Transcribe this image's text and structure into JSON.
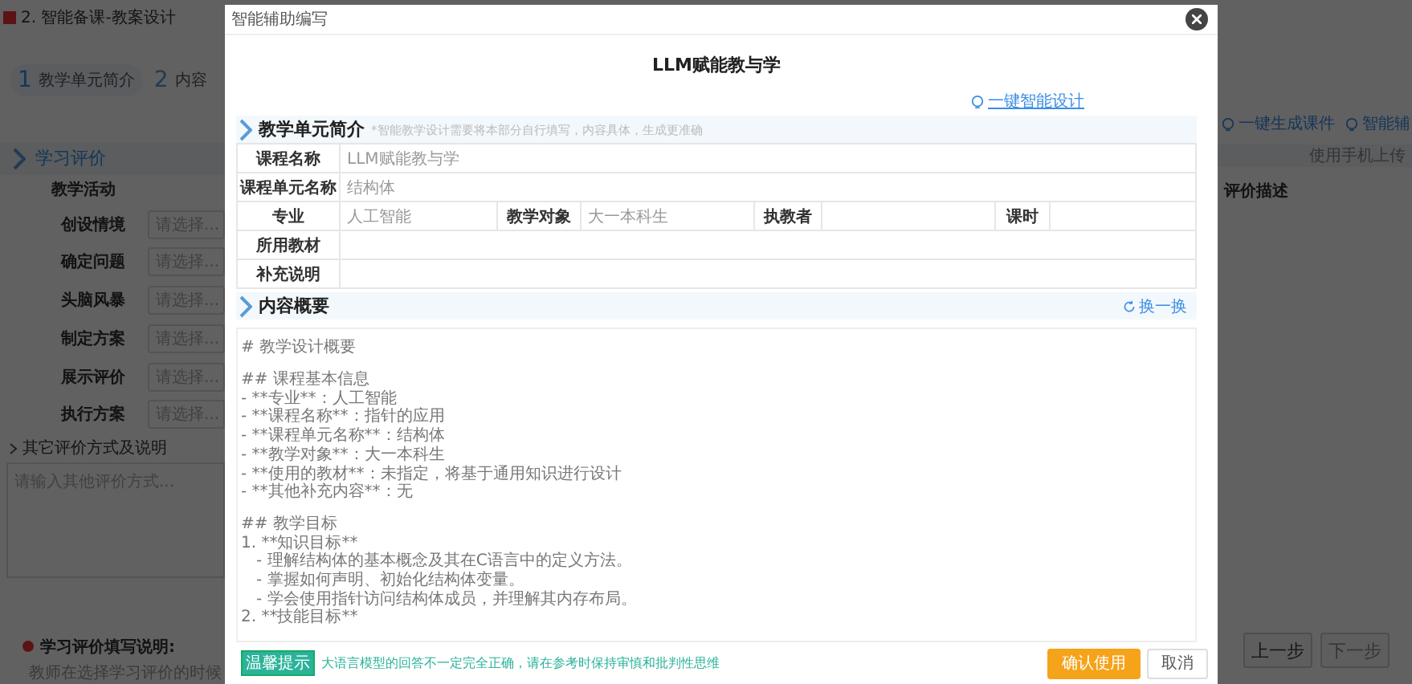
{
  "background": {
    "title": "2. 智能备课-教案设计",
    "steps": [
      {
        "number": "1",
        "label": "教学单元简介",
        "selected": true
      },
      {
        "number": "2",
        "label": "内容",
        "selected": false
      }
    ],
    "section_title": "学习评价",
    "column_header": "教学活动",
    "activities": [
      {
        "label": "创设情境",
        "placeholder": "请选择..."
      },
      {
        "label": "确定问题",
        "placeholder": "请选择..."
      },
      {
        "label": "头脑风暴",
        "placeholder": "请选择..."
      },
      {
        "label": "制定方案",
        "placeholder": "请选择..."
      },
      {
        "label": "展示评价",
        "placeholder": "请选择..."
      },
      {
        "label": "执行方案",
        "placeholder": "请选择..."
      }
    ],
    "other_label": "其它评价方式及说明",
    "other_placeholder": "请输入其他评价方式...",
    "note_title": "学习评价填写说明:",
    "note_text": "教师在选择学习评价的时候",
    "right_actions": [
      "一键生成课件",
      "智能辅"
    ],
    "right_hint": "使用手机上传",
    "right_column": "评价描述",
    "nav_buttons": [
      {
        "label": "上一步",
        "disabled": false
      },
      {
        "label": "下一步",
        "disabled": true
      }
    ]
  },
  "dialog": {
    "title": "智能辅助编写",
    "heading": "LLM赋能教与学",
    "smart_link": "一键智能设计",
    "unit_section": {
      "title": "教学单元简介",
      "note": "*智能教学设计需要将本部分自行填写，内容具体，生成更准确",
      "rows": [
        [
          {
            "kind": "label",
            "text": "课程名称"
          },
          {
            "kind": "value",
            "text": "LLM赋能教与学"
          }
        ],
        [
          {
            "kind": "label",
            "text": "课程单元名称"
          },
          {
            "kind": "value",
            "text": "结构体"
          }
        ],
        [
          {
            "kind": "label",
            "text": "专业"
          },
          {
            "kind": "value",
            "text": "人工智能"
          },
          {
            "kind": "label",
            "text": "教学对象"
          },
          {
            "kind": "value",
            "text": "大一本科生"
          },
          {
            "kind": "label",
            "text": "执教者"
          },
          {
            "kind": "value"
          },
          {
            "kind": "label",
            "text": "课时"
          },
          {
            "kind": "value"
          }
        ],
        [
          {
            "kind": "label",
            "text": "所用教材"
          },
          {
            "kind": "value"
          }
        ],
        [
          {
            "kind": "label",
            "text": "补充说明"
          },
          {
            "kind": "value"
          }
        ]
      ]
    },
    "summary_section": {
      "title": "内容概要",
      "refresh": "换一换",
      "paragraphs": [
        [
          "# 教学设计概要"
        ],
        [
          "## 课程基本信息",
          "- **专业**：人工智能",
          "- **课程名称**：指针的应用",
          "- **课程单元名称**：结构体",
          "- **教学对象**：大一本科生",
          "- **使用的教材**：未指定，将基于通用知识进行设计",
          "- **其他补充内容**：无"
        ],
        [
          "## 教学目标",
          "1. **知识目标**",
          "   - 理解结构体的基本概念及其在C语言中的定义方法。",
          "   - 掌握如何声明、初始化结构体变量。",
          "   - 学会使用指针访问结构体成员，并理解其内存布局。",
          "2. **技能目标**"
        ]
      ]
    },
    "tip_badge": "温馨提示",
    "tip_text": "大语言模型的回答不一定完全正确，请在参考时保持审慎和批判性思维",
    "buttons": [
      {
        "label": "确认使用",
        "kind": "primary"
      },
      {
        "label": "取消",
        "kind": "default"
      }
    ]
  }
}
